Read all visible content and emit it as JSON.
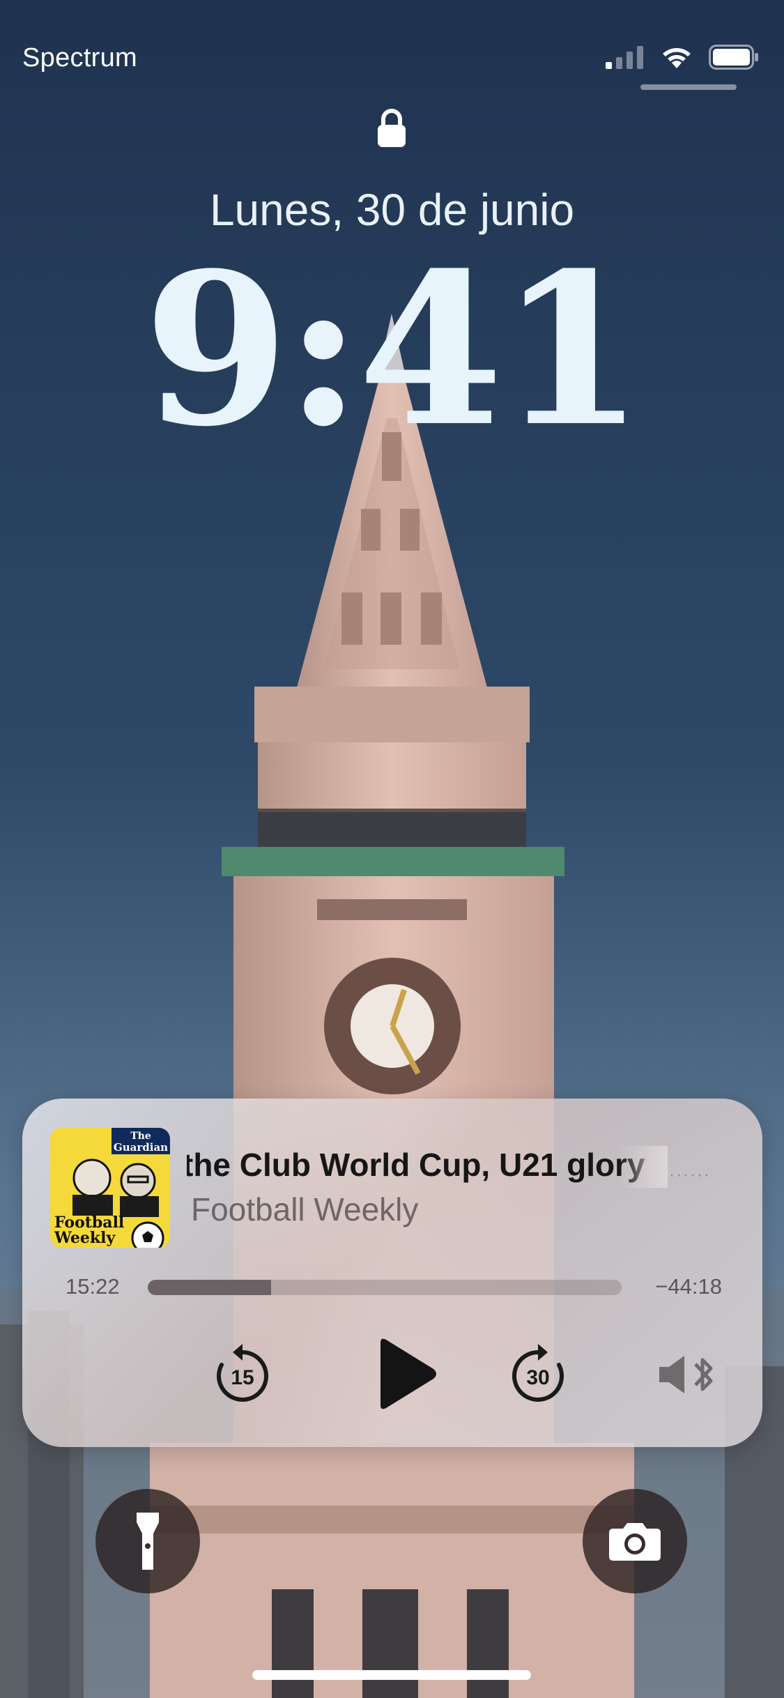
{
  "status_bar": {
    "carrier": "Spectrum",
    "signal_icon": "cellular-signal-icon",
    "wifi_icon": "wifi-icon",
    "battery_icon": "battery-icon"
  },
  "lock_screen": {
    "lock_icon": "lock-icon",
    "date": "Lunes, 30 de junio",
    "time": "9:41"
  },
  "now_playing": {
    "artwork_text": {
      "brand_line1": "The",
      "brand_line2": "Guardian",
      "show_line1": "Football",
      "show_line2": "Weekly"
    },
    "title": "the Club World Cup, U21 glory",
    "show": "Football Weekly",
    "more_icon": "dotted-more-icon",
    "elapsed": "15:22",
    "remaining": "−44:18",
    "progress": 0.26,
    "skip_back_icon": "skip-back-15-icon",
    "skip_back_seconds": "15",
    "play_icon": "play-icon",
    "skip_forward_icon": "skip-forward-30-icon",
    "skip_forward_seconds": "30",
    "audio_route_icon": "bluetooth-speaker-icon"
  },
  "bottom": {
    "flashlight_icon": "flashlight-icon",
    "camera_icon": "camera-icon"
  },
  "colors": {
    "sky_top": "#1f3350",
    "sky_bottom": "#4a6683",
    "tower_stone": "#d8b6aa",
    "card_text": "#161616"
  }
}
